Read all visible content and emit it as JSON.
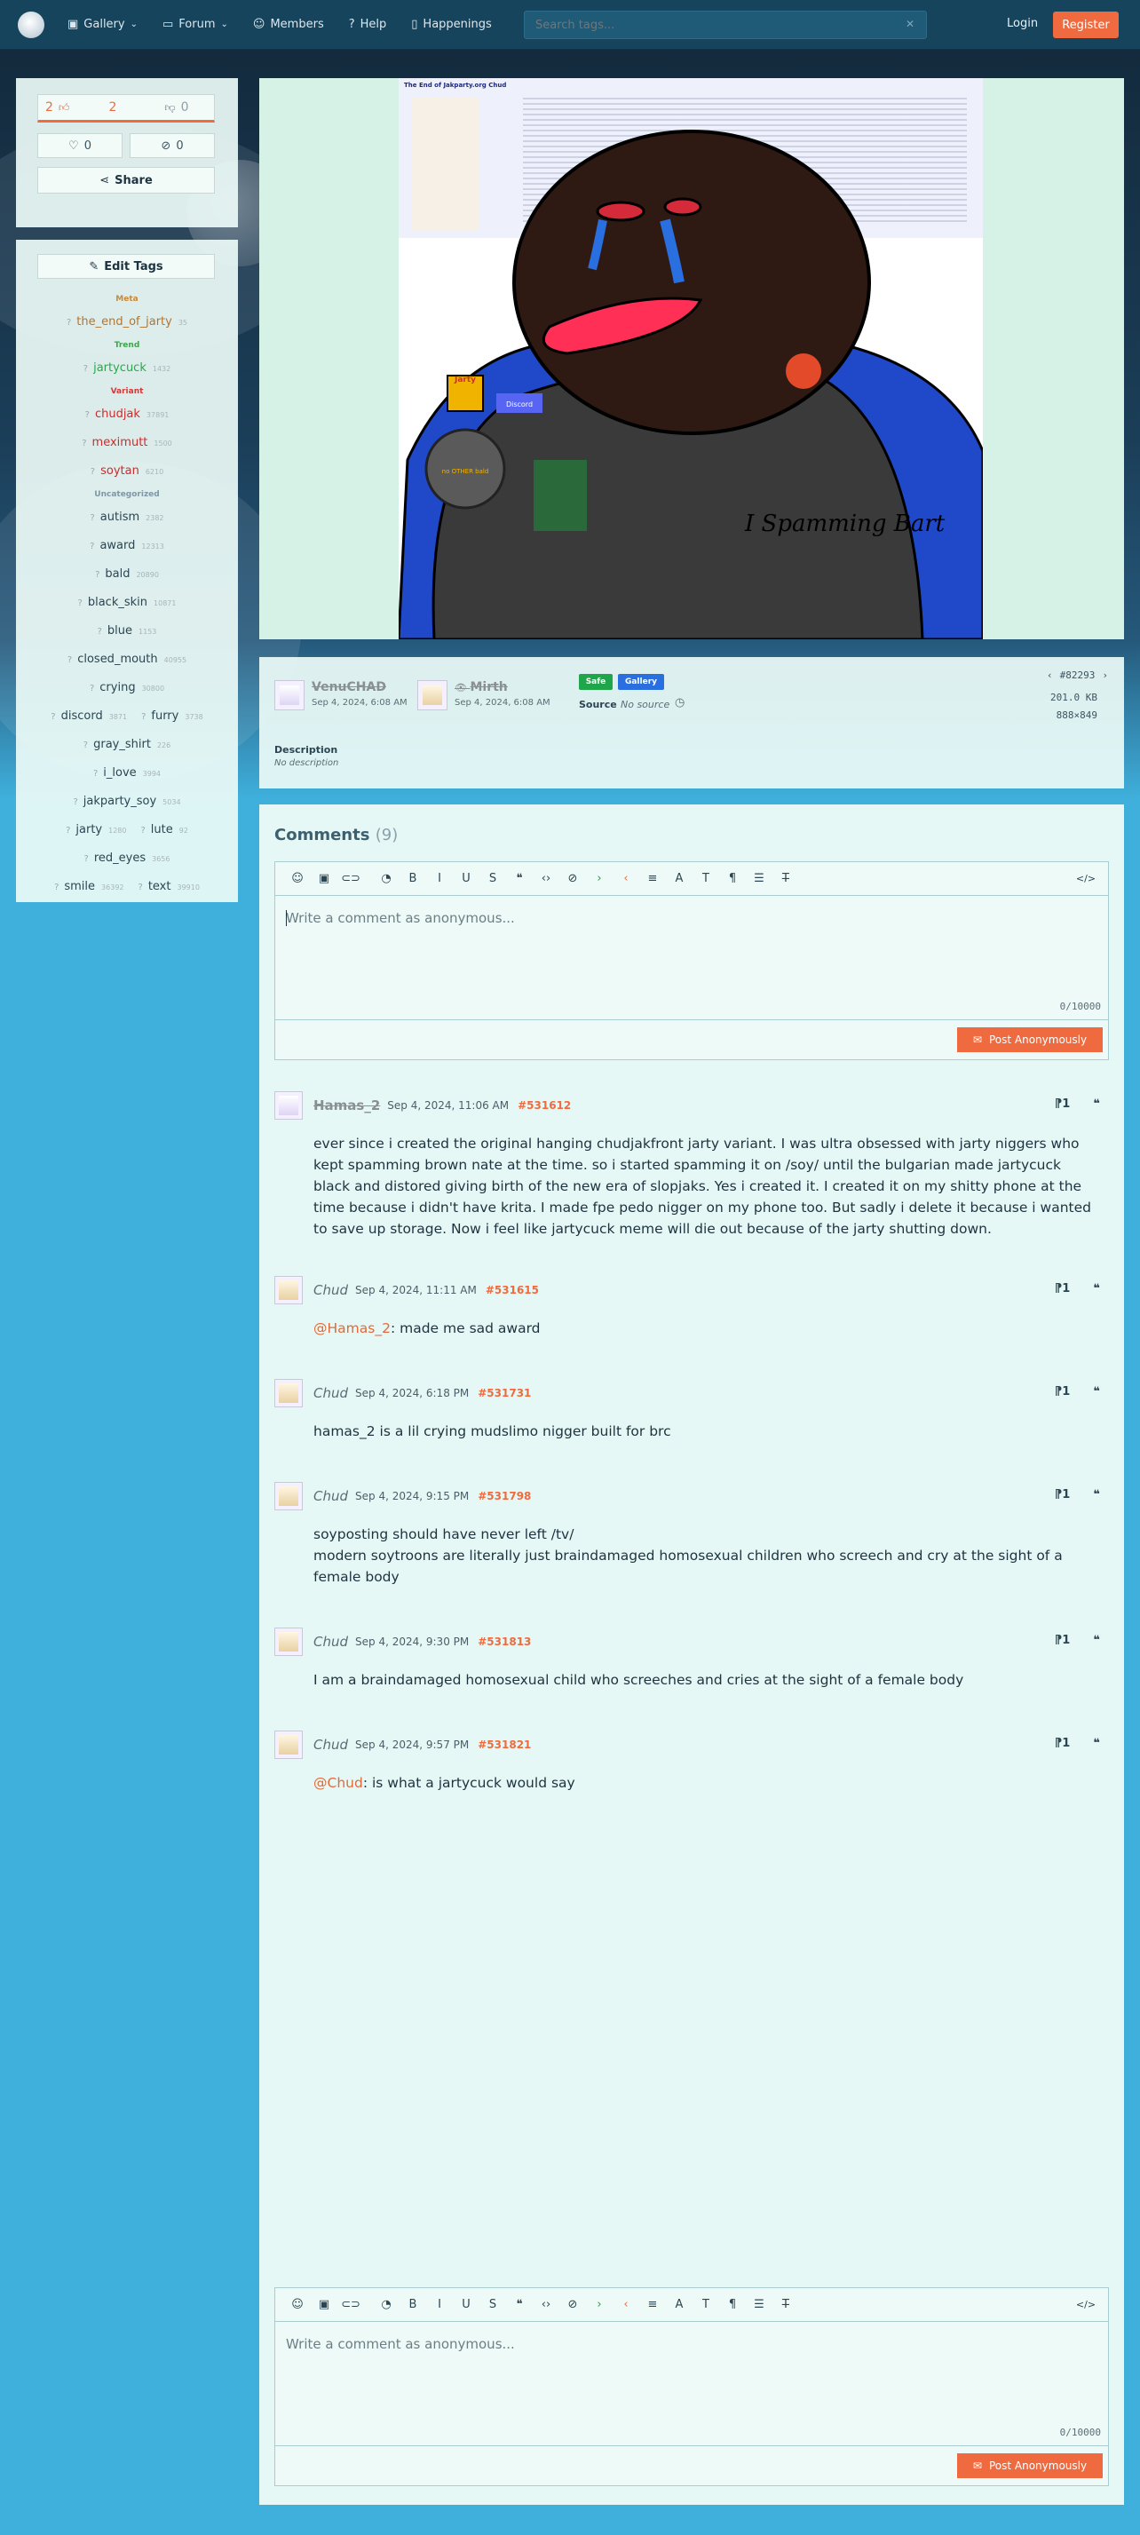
{
  "nav": {
    "gallery": "Gallery",
    "forum": "Forum",
    "members": "Members",
    "help": "Help",
    "happenings": "Happenings",
    "search_placeholder": "Search tags...",
    "login": "Login",
    "register": "Register"
  },
  "votes": {
    "up": "2",
    "score": "2",
    "comments": "0",
    "favorites": "0",
    "hides": "0",
    "share": "Share"
  },
  "tags_panel": {
    "edit_label": "Edit Tags",
    "categories": [
      {
        "name": "Meta",
        "color": "#c78a3a",
        "rows": [
          [
            {
              "name": "the_end_of_jarty",
              "count": "35",
              "color": "#b4742c"
            }
          ]
        ]
      },
      {
        "name": "Trend",
        "color": "#3aa84a",
        "rows": [
          [
            {
              "name": "jartycuck",
              "count": "1432",
              "color": "#2aa84a"
            }
          ]
        ]
      },
      {
        "name": "Variant",
        "color": "#d03a3a",
        "rows": [
          [
            {
              "name": "chudjak",
              "count": "37891",
              "color": "#d02a2a"
            }
          ],
          [
            {
              "name": "meximutt",
              "count": "1500",
              "color": "#d02a2a"
            }
          ],
          [
            {
              "name": "soytan",
              "count": "6210",
              "color": "#d02a2a"
            }
          ]
        ]
      },
      {
        "name": "Uncategorized",
        "color": "#7f97a2",
        "rows": [
          [
            {
              "name": "autism",
              "count": "2382",
              "color": "#2b4552"
            }
          ],
          [
            {
              "name": "award",
              "count": "12313",
              "color": "#2b4552"
            }
          ],
          [
            {
              "name": "bald",
              "count": "20890",
              "color": "#2b4552"
            }
          ],
          [
            {
              "name": "black_skin",
              "count": "10871",
              "color": "#2b4552"
            }
          ],
          [
            {
              "name": "blue",
              "count": "1153",
              "color": "#2b4552"
            }
          ],
          [
            {
              "name": "closed_mouth",
              "count": "40955",
              "color": "#2b4552"
            }
          ],
          [
            {
              "name": "crying",
              "count": "30800",
              "color": "#2b4552"
            }
          ],
          [
            {
              "name": "discord",
              "count": "3871",
              "color": "#2b4552"
            },
            {
              "name": "furry",
              "count": "3738",
              "color": "#2b4552"
            }
          ],
          [
            {
              "name": "gray_shirt",
              "count": "226",
              "color": "#2b4552"
            }
          ],
          [
            {
              "name": "i_love",
              "count": "3994",
              "color": "#2b4552"
            }
          ],
          [
            {
              "name": "jakparty_soy",
              "count": "5034",
              "color": "#2b4552"
            }
          ],
          [
            {
              "name": "jarty",
              "count": "1280",
              "color": "#2b4552"
            },
            {
              "name": "lute",
              "count": "92",
              "color": "#2b4552"
            }
          ],
          [
            {
              "name": "red_eyes",
              "count": "3656",
              "color": "#2b4552"
            }
          ],
          [
            {
              "name": "smile",
              "count": "36392",
              "color": "#2b4552"
            },
            {
              "name": "text",
              "count": "39910",
              "color": "#2b4552"
            }
          ]
        ]
      }
    ]
  },
  "post": {
    "uploader": "VenuCHAD",
    "uploader_date": "Sep 4, 2024, 6:08 AM",
    "approver": "Mirth",
    "approver_date": "Sep 4, 2024, 6:08 AM",
    "rating_badge": "Safe",
    "type_badge": "Gallery",
    "source_label": "Source",
    "source_value": "No source",
    "post_id": "#82293",
    "filesize": "201.0 KB",
    "dimensions": "888×849",
    "description_label": "Description",
    "description_value": "No description",
    "image_header_text": "The End of Jakparty.org Chud",
    "image_shirt_text": "I Spamming Bart",
    "image_medal_text": "Jarty",
    "image_discord_text": "Discord"
  },
  "comments": {
    "title": "Comments",
    "count": "(9)",
    "placeholder": "Write a comment as anonymous...",
    "counter": "0/10000",
    "post_button": "Post Anonymously",
    "items": [
      {
        "name": "Hamas_2",
        "registered": true,
        "date": "Sep 4, 2024, 11:06 AM",
        "id": "#531612",
        "mention": "",
        "text": "ever since i created the original hanging chudjakfront jarty variant. I was ultra obsessed with jarty niggers who kept spamming brown nate at the time. so i started spamming it on /soy/ until the bulgarian made jartycuck black and distored giving birth of the new era of slopjaks. Yes i created it. I created it on my shitty phone at the time because i didn't have krita. I made fpe pedo nigger on my phone too. But sadly i delete it because i wanted to save up storage. Now i feel like jartycuck meme will die out because of the jarty shutting down."
      },
      {
        "name": "Chud",
        "registered": false,
        "date": "Sep 4, 2024, 11:11 AM",
        "id": "#531615",
        "mention": "@Hamas_2",
        "text": ": made me sad award"
      },
      {
        "name": "Chud",
        "registered": false,
        "date": "Sep 4, 2024, 6:18 PM",
        "id": "#531731",
        "mention": "",
        "text": "hamas_2 is a lil crying mudslimo nigger built for brc"
      },
      {
        "name": "Chud",
        "registered": false,
        "date": "Sep 4, 2024, 9:15 PM",
        "id": "#531798",
        "mention": "",
        "text": "soyposting should have never left /tv/\nmodern soytroons are literally just braindamaged homosexual children who screech and cry at the sight of a female body"
      },
      {
        "name": "Chud",
        "registered": false,
        "date": "Sep 4, 2024, 9:30 PM",
        "id": "#531813",
        "mention": "",
        "text": "I am a braindamaged homosexual child who screeches and cries at the sight of a female body"
      },
      {
        "name": "Chud",
        "registered": false,
        "date": "Sep 4, 2024, 9:57 PM",
        "id": "#531821",
        "mention": "@Chud",
        "text": ": is what a jartycuck would say"
      }
    ]
  },
  "colors": {
    "accent": "#ef6b3f",
    "nav_bg": "#15445c",
    "panel_bg": "#ebfaf6",
    "safe_badge": "#1fa54a",
    "gallery_badge": "#2a6fe0"
  }
}
